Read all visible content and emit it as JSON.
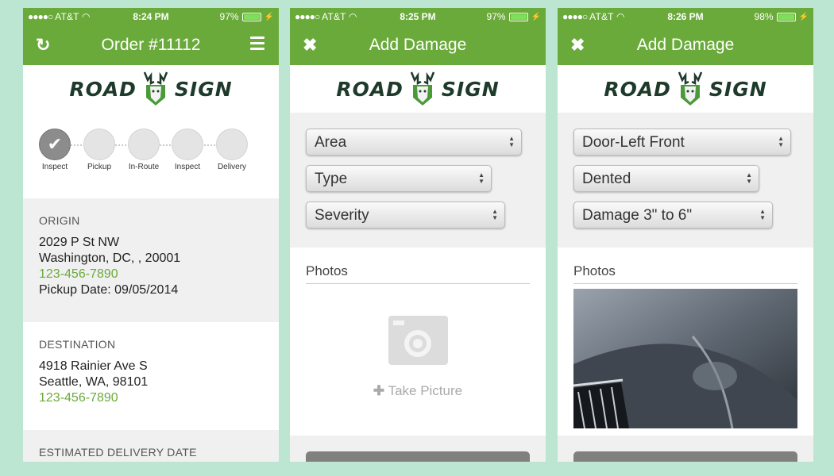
{
  "screens": [
    {
      "status": {
        "carrier": "AT&T",
        "time": "8:24 PM",
        "battery": "97%"
      },
      "nav": {
        "title": "Order #11112",
        "left_icon": "refresh-icon",
        "right_icon": "menu-icon"
      },
      "logo": {
        "left": "ROAD",
        "right": "SIGN"
      },
      "steps": [
        "Inspect",
        "Pickup",
        "In-Route",
        "Inspect",
        "Delivery"
      ],
      "origin": {
        "header": "ORIGIN",
        "street": "2029 P St NW",
        "city": "Washington, DC, , 20001",
        "phone": "123-456-7890",
        "pickup_date": "Pickup Date: 09/05/2014"
      },
      "destination": {
        "header": "DESTINATION",
        "street": "4918 Rainier Ave S",
        "city": "Seattle, WA, 98101",
        "phone": "123-456-7890"
      },
      "estimated": {
        "header": "ESTIMATED DELIVERY DATE"
      }
    },
    {
      "status": {
        "carrier": "AT&T",
        "time": "8:25 PM",
        "battery": "97%"
      },
      "nav": {
        "title": "Add Damage",
        "left_icon": "close-icon"
      },
      "logo": {
        "left": "ROAD",
        "right": "SIGN"
      },
      "selects": [
        "Area",
        "Type",
        "Severity"
      ],
      "photos": {
        "header": "Photos",
        "take_picture": "Take Picture",
        "camera_icon": "camera-icon",
        "plus_icon": "plus-icon"
      }
    },
    {
      "status": {
        "carrier": "AT&T",
        "time": "8:26 PM",
        "battery": "98%"
      },
      "nav": {
        "title": "Add Damage",
        "left_icon": "close-icon"
      },
      "logo": {
        "left": "ROAD",
        "right": "SIGN"
      },
      "selects": [
        "Door-Left Front",
        "Dented",
        "Damage 3\" to 6\""
      ],
      "photos": {
        "header": "Photos"
      }
    }
  ],
  "colors": {
    "brand_green": "#6aaa3a",
    "background": "#bde6d2",
    "logo_dark": "#1d3a2a"
  }
}
